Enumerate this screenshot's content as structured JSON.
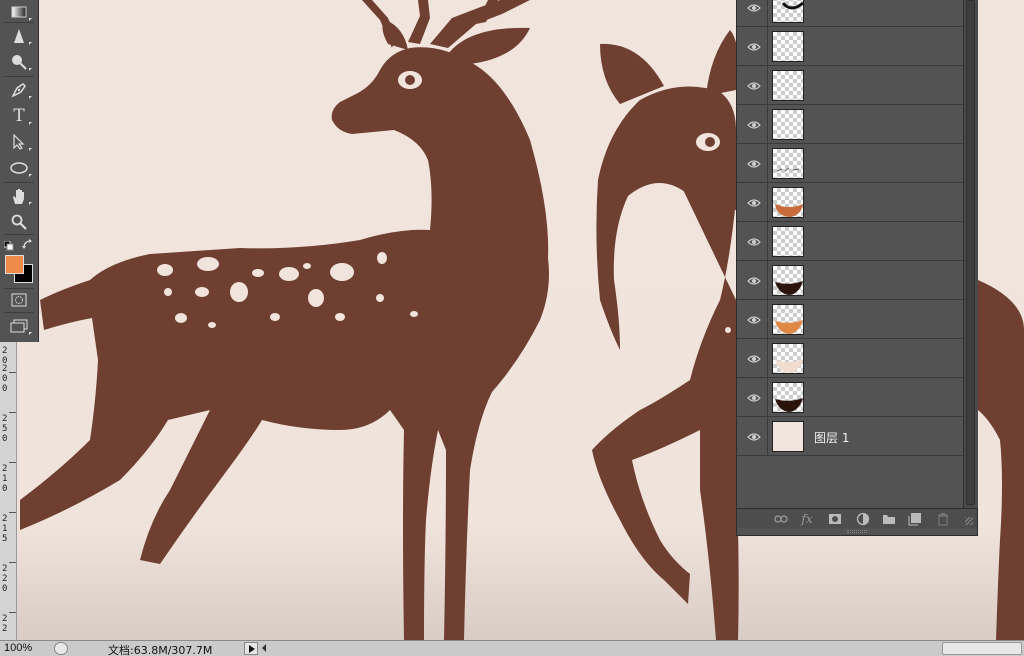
{
  "toolbox": {
    "tools": [
      "gradient-tool",
      "sharpen-tool",
      "dodge-tool",
      "pen-tool",
      "type-tool",
      "path-selection-tool",
      "ellipse-tool",
      "hand-tool",
      "zoom-tool",
      "default-colors",
      "swap-colors",
      "quick-mask",
      "screen-mode"
    ],
    "foreground_color": "#f08a4b",
    "background_color": "#000000",
    "type_glyph": "T"
  },
  "ruler": {
    "labels": [
      "2\n0",
      "2\n0\n0",
      "2\n5\n0",
      "2\n1\n0",
      "2\n1\n5",
      "2\n2\n0",
      "2\n2"
    ]
  },
  "canvas": {
    "artwork": "two-deer-illustration",
    "deer_color": "#6f3f31",
    "background_color": "#f1e4dc"
  },
  "layers_panel": {
    "layers": [
      {
        "name": "",
        "thumb": "dark-stroke",
        "visible": true
      },
      {
        "name": "",
        "thumb": "empty",
        "visible": true
      },
      {
        "name": "",
        "thumb": "empty",
        "visible": true
      },
      {
        "name": "",
        "thumb": "empty",
        "visible": true
      },
      {
        "name": "",
        "thumb": "text-sketch",
        "visible": true
      },
      {
        "name": "",
        "thumb": "orange-bowl",
        "visible": true
      },
      {
        "name": "",
        "thumb": "empty",
        "visible": true
      },
      {
        "name": "",
        "thumb": "dark-bowl",
        "visible": true
      },
      {
        "name": "",
        "thumb": "light-orange-bowl",
        "visible": true
      },
      {
        "name": "",
        "thumb": "pale-bowl",
        "visible": true
      },
      {
        "name": "",
        "thumb": "dark-bowl",
        "visible": true
      },
      {
        "name": "图层 1",
        "thumb": "solid-beige",
        "visible": true
      }
    ],
    "bottom_buttons": [
      "link-layers",
      "fx",
      "add-mask",
      "adjustment-layer",
      "new-group",
      "new-layer",
      "delete-layer"
    ],
    "fx_label": "fx"
  },
  "statusbar": {
    "zoom": "100%",
    "doc_info": "文档:63.8M/307.7M"
  }
}
